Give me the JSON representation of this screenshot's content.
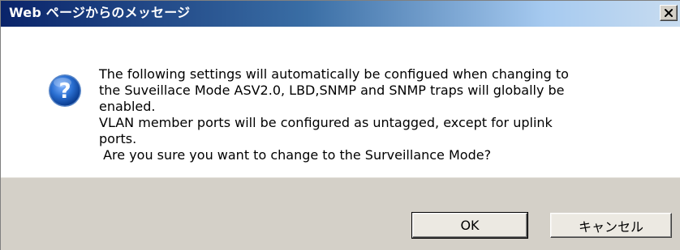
{
  "dialog": {
    "title": "Web ページからのメッセージ",
    "close_icon": "close-icon",
    "icon": "question-icon",
    "message_lines": [
      "The following settings will automatically be configued when changing to",
      "the Suveillace Mode ASV2.0, LBD,SNMP and SNMP traps will globally be",
      "enabled.",
      "VLAN member ports will be configured as untagged, except for uplink",
      "ports.",
      " Are you sure you want to change to the Surveillance Mode?"
    ],
    "buttons": {
      "ok_label": "OK",
      "cancel_label": "キャンセル"
    }
  },
  "colors": {
    "titlebar_start": "#0a246a",
    "titlebar_end": "#c8dcf0",
    "footer_bg": "#d4d0c8",
    "icon_blue": "#1f5fb8"
  }
}
